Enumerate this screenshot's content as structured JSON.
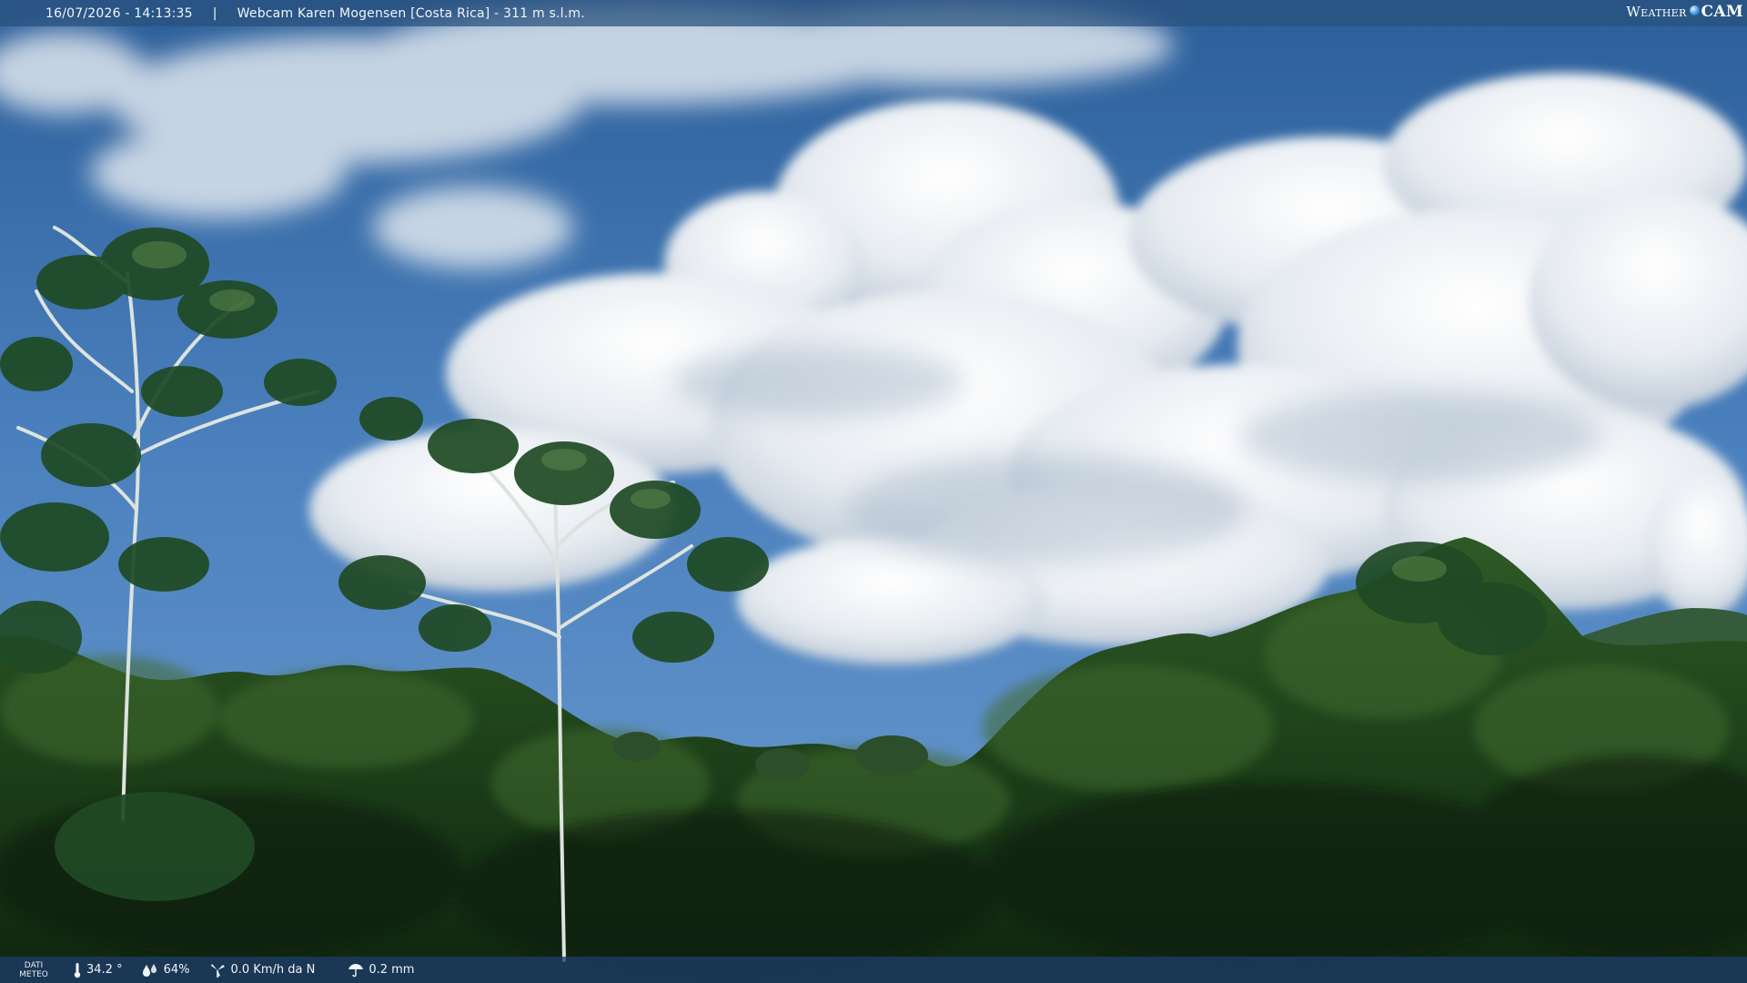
{
  "header": {
    "timestamp": "16/07/2026 - 14:13:35",
    "separator": "|",
    "camera_title": "Webcam Karen Mogensen [Costa Rica] - 311 m s.l.m."
  },
  "brand": {
    "weather": "Weather",
    "cam": "CAM",
    "icon": "globe-icon"
  },
  "weather_bar": {
    "label_line1": "DATI",
    "label_line2": "METEO",
    "temperature": "34.2 °",
    "humidity": "64%",
    "wind": "0.0 Km/h da N",
    "rain": "0.2 mm",
    "icons": [
      "thermometer-icon",
      "humidity-icon",
      "wind-icon",
      "rain-gauge-icon"
    ]
  },
  "colors": {
    "sky_top": "#2c5f99",
    "sky_mid": "#4f86c2",
    "cloud": "#f4f6f8",
    "foliage_dark": "#0f2a12",
    "foliage_mid": "#2e5a22",
    "bar_bg": "#2a4f7c"
  }
}
